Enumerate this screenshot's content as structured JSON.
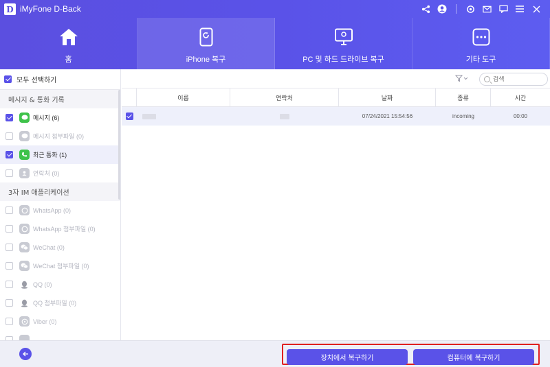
{
  "app": {
    "logo_letter": "D",
    "title": "iMyFone D-Back"
  },
  "window_icons": [
    "share-icon",
    "account-icon",
    "settings-icon",
    "mail-icon",
    "feedback-icon",
    "menu-icon",
    "close-icon"
  ],
  "tabs": [
    {
      "label": "홈",
      "icon": "home-icon",
      "active": false
    },
    {
      "label": "iPhone 복구",
      "icon": "iphone-recovery-icon",
      "active": true
    },
    {
      "label": "PC 및 하드 드라이브 복구",
      "icon": "pc-drive-icon",
      "active": false
    },
    {
      "label": "기타 도구",
      "icon": "more-tools-icon",
      "active": false
    }
  ],
  "sidebar": {
    "select_all": "모두 선택하기",
    "section1": "메시지 & 통화 기록",
    "items1": [
      {
        "label": "메시지 (6)",
        "checked": true,
        "icon": "message-icon",
        "state": "normal"
      },
      {
        "label": "메시지 첨부파일 (0)",
        "checked": false,
        "icon": "attachment-icon",
        "state": "disabled"
      },
      {
        "label": "최근 통화 (1)",
        "checked": true,
        "icon": "phone-icon",
        "state": "selected"
      },
      {
        "label": "연락처 (0)",
        "checked": false,
        "icon": "contacts-icon",
        "state": "disabled"
      }
    ],
    "section2": "3자 IM 애플리케이션",
    "items2": [
      {
        "label": "WhatsApp (0)",
        "icon": "whatsapp-icon"
      },
      {
        "label": "WhatsApp 첨부파일 (0)",
        "icon": "whatsapp-icon"
      },
      {
        "label": "WeChat (0)",
        "icon": "wechat-icon"
      },
      {
        "label": "WeChat 첨부파일 (0)",
        "icon": "wechat-icon"
      },
      {
        "label": "QQ (0)",
        "icon": "qq-icon"
      },
      {
        "label": "QQ 첨부파일 (0)",
        "icon": "qq-icon"
      },
      {
        "label": "Viber (0)",
        "icon": "viber-icon"
      }
    ]
  },
  "search": {
    "placeholder": "검색"
  },
  "table": {
    "headers": [
      "이름",
      "연락처",
      "날짜",
      "종류",
      "시간"
    ],
    "rows": [
      {
        "checked": true,
        "date": "07/24/2021 15:54:56",
        "type": "incoming",
        "time": "00:00"
      }
    ]
  },
  "footer": {
    "restore_device": "장치에서 복구하기",
    "restore_computer": "컴퓨터에 복구하기"
  },
  "colors": {
    "accent": "#5a52e8",
    "highlight_border": "#e02020"
  }
}
